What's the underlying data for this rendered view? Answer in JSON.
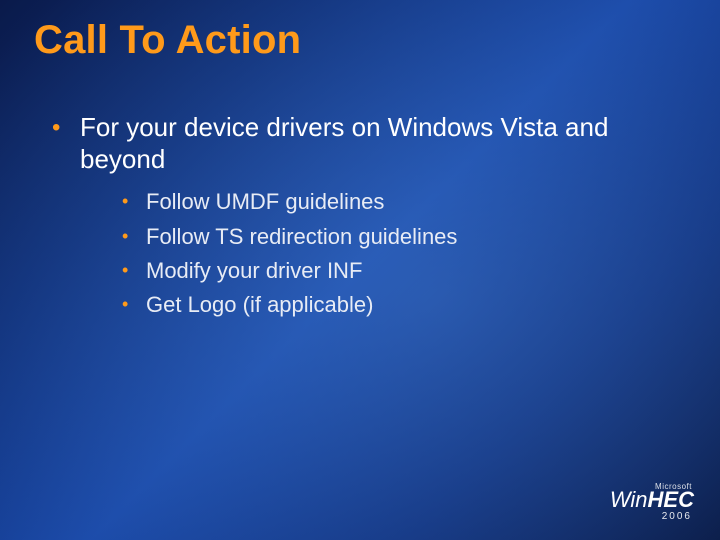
{
  "title": "Call To Action",
  "main_bullet": "For your device drivers on Windows Vista and beyond",
  "sub_bullets": [
    "Follow UMDF guidelines",
    "Follow TS redirection guidelines",
    "Modify your driver INF",
    "Get Logo (if applicable)"
  ],
  "logo": {
    "vendor": "Microsoft",
    "name_prefix": "Win",
    "name_suffix": "HEC",
    "year": "2006"
  }
}
